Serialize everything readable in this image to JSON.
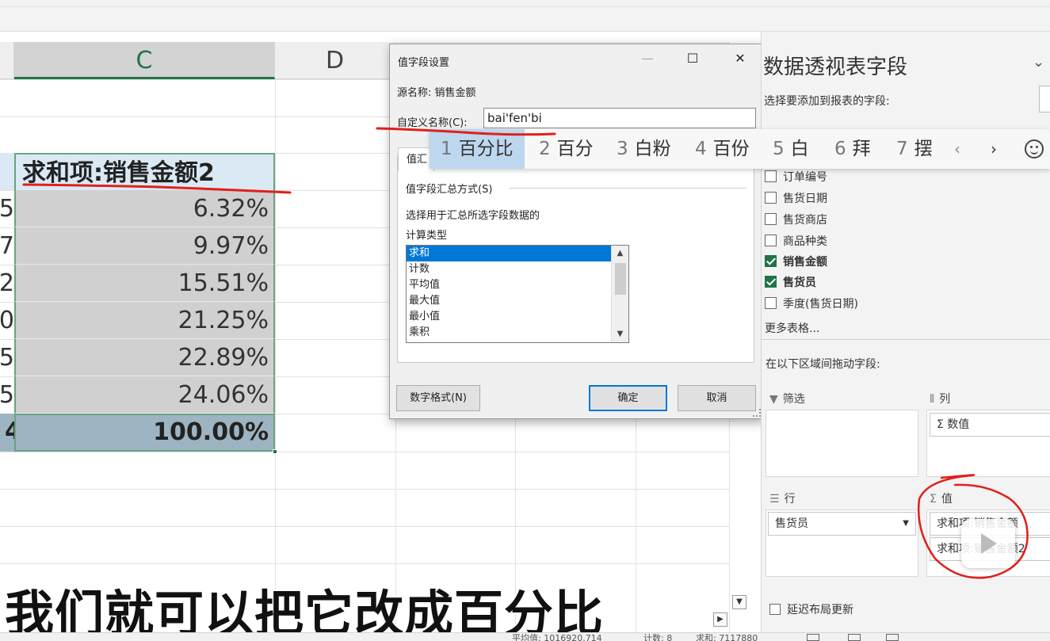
{
  "sheet": {
    "columns": [
      "C",
      "D"
    ],
    "pivot_header": "求和项:销售金额2",
    "row_edge_digits": [
      "5",
      "7",
      "2",
      "0",
      "5",
      "5"
    ],
    "values": [
      "6.32%",
      "9.97%",
      "15.51%",
      "21.25%",
      "22.89%",
      "24.06%"
    ],
    "total_edge_digit": "4",
    "total_value": "100.00%"
  },
  "dialog": {
    "title": "值字段设置",
    "minimize": "—",
    "maximize": "☐",
    "close": "✕",
    "source_name": "源名称:  销售金额",
    "custom_name_label": "自定义名称(C):",
    "custom_name_value": "bai'fen'bi",
    "tab_fragment": "值汇",
    "section_label": "值字段汇总方式(S)",
    "description_line1": "选择用于汇总所选字段数据的",
    "description_line2": "计算类型",
    "calc_types": [
      "求和",
      "计数",
      "平均值",
      "最大值",
      "最小值",
      "乘积"
    ],
    "number_format_button": "数字格式(N)",
    "ok_button": "确定",
    "cancel_button": "取消"
  },
  "ime": {
    "candidates": [
      {
        "num": "1",
        "text": "百分比"
      },
      {
        "num": "2",
        "text": "百分"
      },
      {
        "num": "3",
        "text": "白粉"
      },
      {
        "num": "4",
        "text": "百份"
      },
      {
        "num": "5",
        "text": "白"
      },
      {
        "num": "6",
        "text": "拜"
      },
      {
        "num": "7",
        "text": "摆"
      }
    ],
    "prev": "‹",
    "next": "›"
  },
  "pane": {
    "title": "数据透视表字段",
    "dropdown": "⌄",
    "prompt": "选择要添加到报表的字段:",
    "fields": [
      {
        "label": "订单编号",
        "checked": false
      },
      {
        "label": "售货日期",
        "checked": false
      },
      {
        "label": "售货商店",
        "checked": false
      },
      {
        "label": "商品种类",
        "checked": false
      },
      {
        "label": "销售金额",
        "checked": true
      },
      {
        "label": "售货员",
        "checked": true
      },
      {
        "label": "季度(售货日期)",
        "checked": false
      }
    ],
    "more_tables": "更多表格...",
    "drag_prompt": "在以下区域间拖动字段:",
    "filter_label": "筛选",
    "columns_label": "列",
    "columns_item": "Σ 数值",
    "rows_label": "行",
    "rows_item": "售货员",
    "values_label": "值",
    "values_items": [
      "求和项:销售金额",
      "求和项:销售金额2"
    ],
    "defer_label": "延迟布局更新"
  },
  "status": {
    "average": "平均值: 1016920.714",
    "count": "计数: 8",
    "sum": "求和: 7117880"
  },
  "subtitle": "我们就可以把它改成百分比",
  "colors": {
    "excel_green": "#217346",
    "selection_blue": "#0078d7",
    "annotation_red": "#e0201b",
    "pivot_header_bg": "#dbe9f5",
    "total_bg": "#9db4c2"
  }
}
